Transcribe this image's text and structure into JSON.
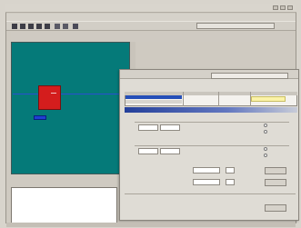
{
  "window": {
    "title": "",
    "menu": [
      "",
      "",
      "",
      "",
      "",
      ""
    ]
  },
  "toolbar": {
    "field_text": ""
  },
  "panel": {
    "header": ""
  },
  "canvas": {
    "background": "#057a79",
    "block_color": "#d41d1d",
    "tag_color": "#1f40d2",
    "tag_label": ""
  },
  "log": {
    "lines": [
      "",
      "",
      "",
      "",
      "",
      "",
      ""
    ]
  },
  "dialog": {
    "title": "",
    "subtitle": "",
    "table": {
      "columns": [
        "",
        "",
        "",
        ""
      ],
      "rows": [
        {
          "cells": [
            "",
            "",
            "",
            ""
          ]
        },
        {
          "cells": [
            "",
            "",
            "",
            ""
          ]
        }
      ]
    },
    "group1_label": "",
    "group2_label": "",
    "field_labels": [
      "",
      ""
    ],
    "options": [
      "",
      "",
      "",
      ""
    ],
    "buttons": [
      "",
      "",
      ""
    ]
  }
}
